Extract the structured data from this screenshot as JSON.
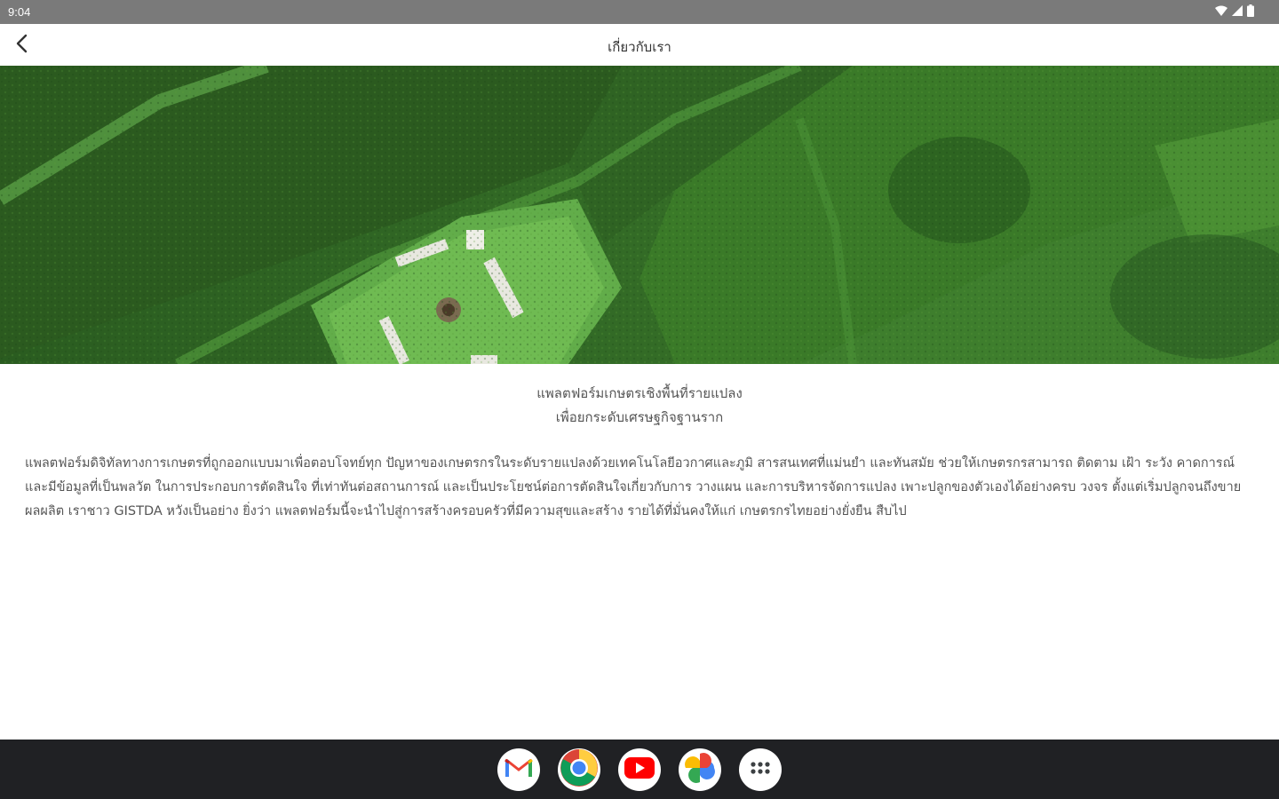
{
  "status_bar": {
    "time": "9:04",
    "icons": [
      "wifi-icon",
      "signal-icon",
      "battery-icon"
    ]
  },
  "app_bar": {
    "title": "เกี่ยวกับเรา",
    "back_icon": "arrow-back-icon"
  },
  "hero": {
    "description": "aerial-farm-field-photo"
  },
  "content": {
    "tagline_line1": "แพลตฟอร์มเกษตรเชิงพื้นที่รายแปลง",
    "tagline_line2": "เพื่อยกระดับเศรษฐกิจฐานราก",
    "description": "แพลตฟอร์มดิจิทัลทางการเกษตรที่ถูกออกแบบมาเพื่อตอบโจทย์ทุก ปัญหาของเกษตรกรในระดับรายแปลงด้วยเทคโนโลยีอวกาศและภูมิ สารสนเทศที่แม่นยำ และทันสมัย ช่วยให้เกษตรกรสามารถ ติดตาม เฝ้า ระวัง คาดการณ์ และมีข้อมูลที่เป็นพลวัต ในการประกอบการตัดสินใจ ที่เท่าทันต่อสถานการณ์ และเป็นประโยชน์ต่อการตัดสินใจเกี่ยวกับการ วางแผน และการบริหารจัดการแปลง เพาะปลูกของตัวเองได้อย่างครบ วงจร ตั้งแต่เริ่มปลูกจนถึงขายผลผลิต เราชาว GISTDA หวังเป็นอย่าง ยิ่งว่า แพลตฟอร์มนี้จะนำไปสู่การสร้างครอบครัวที่มีความสุขและสร้าง รายได้ที่มั่นคงให้แก่ เกษตรกรไทยอย่างยั่งยืน สืบไป"
  },
  "dock": {
    "apps": [
      {
        "name": "gmail-icon",
        "color": "#ea4335"
      },
      {
        "name": "chrome-icon",
        "color": "#4285f4"
      },
      {
        "name": "youtube-icon",
        "color": "#ff0000"
      },
      {
        "name": "photos-icon",
        "color": "#fbbc04"
      },
      {
        "name": "app-drawer-icon",
        "color": "#3c4043"
      }
    ]
  },
  "colors": {
    "status_bar": "#7a7a7a",
    "nav_bar": "#202124",
    "text": "#555555"
  }
}
